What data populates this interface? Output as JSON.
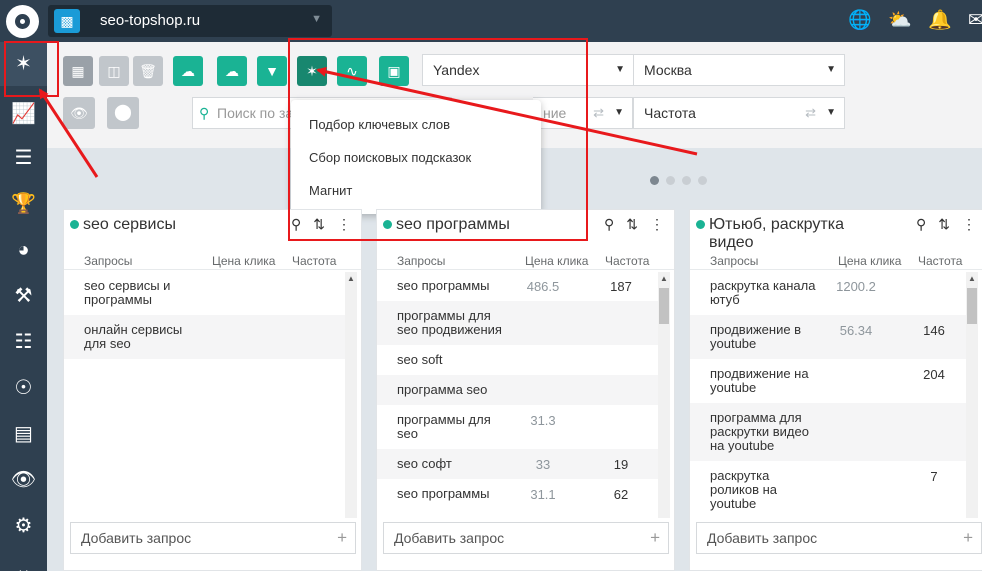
{
  "header": {
    "site": "seo-topshop.ru",
    "icons": [
      "globe-icon",
      "weather-icon",
      "bell-icon",
      "mail-icon"
    ]
  },
  "sidebar": {
    "items": [
      "network-icon",
      "chart-icon",
      "layers-icon",
      "trophy-icon",
      "pie-icon",
      "gavel-icon",
      "sitemap-icon",
      "lifebuoy-icon",
      "list-icon",
      "eye-icon",
      "gear-icon",
      "arrows-icon"
    ]
  },
  "toolbar": {
    "search_placeholder": "Поиск по запросу",
    "engine": "Yandex",
    "region": "Москва",
    "partial_label": "ние",
    "sort": "Частота"
  },
  "dropdown": {
    "items": [
      "Подбор ключевых слов",
      "Сбор поисковых подсказок",
      "Магнит"
    ]
  },
  "columns": [
    {
      "title": "seo сервисы",
      "headers": [
        "Запросы",
        "Цена клика",
        "Частота"
      ],
      "rows": [
        {
          "q": "seo сервисы и программы",
          "p": "",
          "f": ""
        },
        {
          "q": "онлайн сервисы для seo",
          "p": "",
          "f": ""
        }
      ],
      "add": "Добавить запрос"
    },
    {
      "title": "seo программы",
      "headers": [
        "Запросы",
        "Цена клика",
        "Частота"
      ],
      "rows": [
        {
          "q": "seo программы",
          "p": "486.5",
          "f": "187"
        },
        {
          "q": "программы для seo продвижения",
          "p": "",
          "f": ""
        },
        {
          "q": "seo soft",
          "p": "",
          "f": ""
        },
        {
          "q": "программа seo",
          "p": "",
          "f": ""
        },
        {
          "q": "программы для seo",
          "p": "31.3",
          "f": ""
        },
        {
          "q": "seo софт",
          "p": "33",
          "f": "19"
        },
        {
          "q": "seo программы",
          "p": "31.1",
          "f": "62"
        }
      ],
      "add": "Добавить запрос"
    },
    {
      "title": "Ютьюб, раскрутка видео",
      "headers": [
        "Запросы",
        "Цена клика",
        "Частота"
      ],
      "rows": [
        {
          "q": "раскрутка канала ютуб",
          "p": "1200.2",
          "f": ""
        },
        {
          "q": "продвижение в youtube",
          "p": "56.34",
          "f": "146"
        },
        {
          "q": "продвижение на youtube",
          "p": "",
          "f": "204"
        },
        {
          "q": "программа для раскрутки видео на youtube",
          "p": "",
          "f": ""
        },
        {
          "q": "раскрутка роликов на youtube",
          "p": "",
          "f": "7"
        }
      ],
      "add": "Добавить запрос"
    }
  ],
  "colors": {
    "accent": "#1ab394",
    "sidebar": "#2f4050",
    "annotation": "#e8191c"
  }
}
